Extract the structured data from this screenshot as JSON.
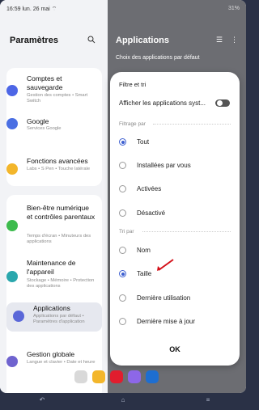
{
  "status": {
    "time": "16:59",
    "date": "lun. 26 mai",
    "right": "31%"
  },
  "left_pane": {
    "title": "Paramètres",
    "items": [
      {
        "title": "Comptes et sauvegarde",
        "sub": "Gestion des comptes • Smart Switch",
        "icon": "account-icon",
        "color": "#4d66e6"
      },
      {
        "title": "Google",
        "sub": "Services Google",
        "icon": "google-icon",
        "color": "#4a6fe3"
      },
      {
        "title": "Fonctions avancées",
        "sub": "Labs • S Pen • Touche latérale",
        "icon": "advanced-icon",
        "color": "#f3b62b"
      },
      {
        "title": "Bien-être numérique et contrôles parentaux",
        "sub": "Temps d'écran • Minuteurs des applications",
        "icon": "wellbeing-icon",
        "color": "#3dbb4d"
      },
      {
        "title": "Maintenance de l'appareil",
        "sub": "Stockage • Mémoire • Protection des applications",
        "icon": "maintenance-icon",
        "color": "#2aa7ad"
      },
      {
        "title": "Applications",
        "sub": "Applications par défaut • Paramètres d'application",
        "icon": "apps-icon",
        "color": "#5a67d8"
      },
      {
        "title": "Gestion globale",
        "sub": "Langue et clavier • Date et heure",
        "icon": "general-icon",
        "color": "#6f63cf"
      }
    ]
  },
  "right_pane": {
    "title": "Applications",
    "subtitle": "Choix des applications par défaut"
  },
  "dialog": {
    "title": "Filtre et tri",
    "toggle_label": "Afficher les applications syst...",
    "filter_label": "Filtrage par",
    "filter_options": [
      {
        "label": "Tout",
        "selected": true
      },
      {
        "label": "Installées par vous",
        "selected": false
      },
      {
        "label": "Activées",
        "selected": false
      },
      {
        "label": "Désactivé",
        "selected": false
      }
    ],
    "sort_label": "Tri par",
    "sort_options": [
      {
        "label": "Nom",
        "selected": false
      },
      {
        "label": "Taille",
        "selected": true
      },
      {
        "label": "Dernière utilisation",
        "selected": false
      },
      {
        "label": "Dernière mise à jour",
        "selected": false
      }
    ],
    "ok": "OK"
  }
}
